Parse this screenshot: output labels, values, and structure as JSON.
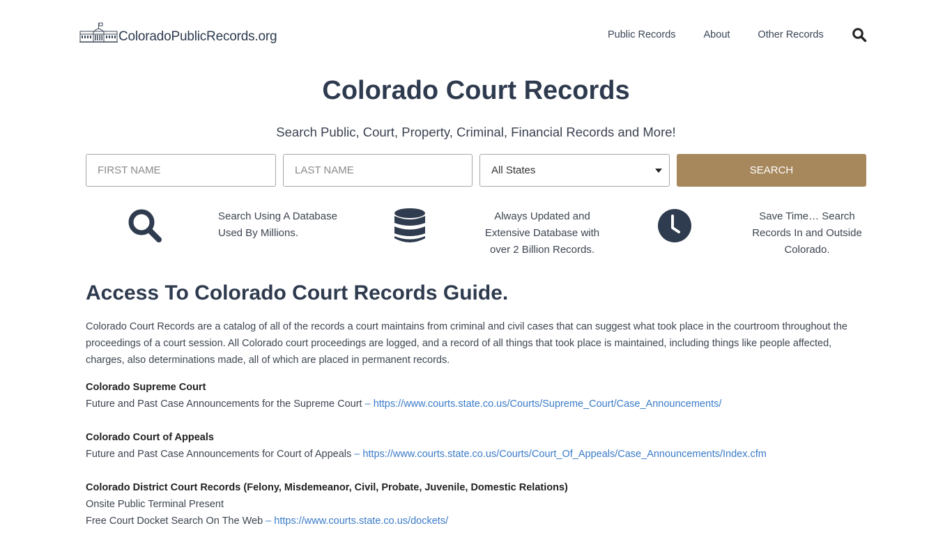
{
  "header": {
    "logo_text": "ColoradoPublicRecords.org",
    "nav": [
      "Public Records",
      "About",
      "Other Records"
    ],
    "search_icon": "search-icon"
  },
  "hero": {
    "title": "Colorado Court Records",
    "subtitle": "Search Public, Court, Property, Criminal, Financial Records and More!"
  },
  "form": {
    "first_name_placeholder": "FIRST NAME",
    "last_name_placeholder": "LAST NAME",
    "first_name_value": "",
    "last_name_value": "",
    "state_selected": "All States",
    "search_label": "SEARCH",
    "button_color": "#a7875c"
  },
  "features": [
    {
      "icon": "search-icon",
      "lines": [
        "Search Using A Database",
        "Used By Millions."
      ]
    },
    {
      "icon": "database-icon",
      "lines": [
        "Always Updated and",
        "Extensive Database with",
        "over 2 Billion Records."
      ]
    },
    {
      "icon": "clock-icon",
      "lines": [
        "Save Time… Search",
        "Records In and Outside",
        "Colorado."
      ]
    }
  ],
  "article": {
    "heading": "Access To Colorado Court Records Guide.",
    "intro": "Colorado Court Records are a catalog of all of the records a court maintains from criminal and civil cases that can suggest what took place in the courtroom throughout the proceedings of a court session. All Colorado court proceedings are logged, and a record of all things that took place is maintained, including things like people affected, charges, also determinations made, all of which are placed in permanent records.",
    "sections": [
      {
        "title": "Colorado Supreme Court",
        "lines": [
          {
            "text": "Future and Past Case Announcements for the Supreme Court",
            "dash": " – ",
            "link": "https://www.courts.state.co.us/Courts/Supreme_Court/Case_Announcements/"
          }
        ]
      },
      {
        "title": "Colorado Court of Appeals",
        "lines": [
          {
            "text": "Future and Past Case Announcements for Court of Appeals",
            "dash": " – ",
            "link": "https://www.courts.state.co.us/Courts/Court_Of_Appeals/Case_Announcements/Index.cfm"
          }
        ]
      },
      {
        "title": "Colorado District Court Records (Felony, Misdemeanor, Civil, Probate, Juvenile, Domestic Relations)",
        "lines": [
          {
            "text": "Onsite Public Terminal Present",
            "dash": "",
            "link": ""
          },
          {
            "text": "Free Court Docket Search On The Web",
            "dash": " – ",
            "link": "https://www.courts.state.co.us/dockets/"
          }
        ]
      }
    ]
  },
  "colors": {
    "heading": "#2e3a4e",
    "link": "#3a7bc8",
    "accent": "#a7875c",
    "icon": "#2f3b4e"
  }
}
